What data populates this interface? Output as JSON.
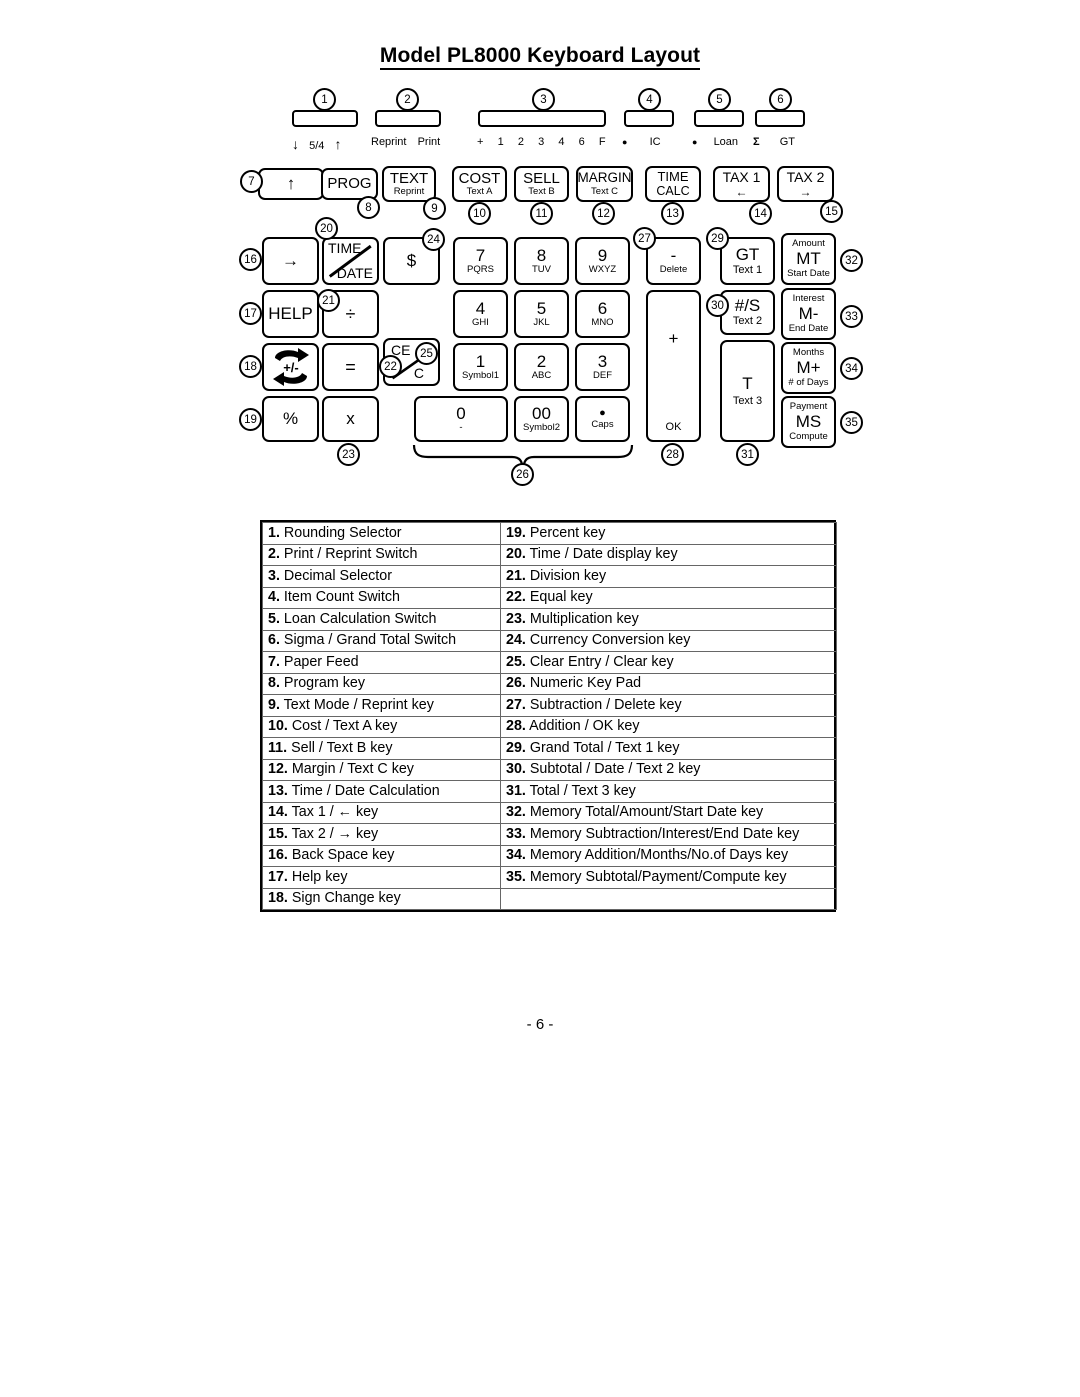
{
  "document": {
    "title": "Model PL8000 Keyboard Layout",
    "page_number": "- 6 -"
  },
  "switches": [
    {
      "callout": "1",
      "labels": [
        "↓",
        "5/4",
        "↑"
      ]
    },
    {
      "callout": "2",
      "labels": [
        "Reprint",
        "Print"
      ]
    },
    {
      "callout": "3",
      "labels": [
        "+",
        "1",
        "2",
        "3",
        "4",
        "6",
        "F"
      ]
    },
    {
      "callout": "4",
      "labels": [
        "●",
        "IC"
      ]
    },
    {
      "callout": "5",
      "labels": [
        "●",
        "Loan"
      ]
    },
    {
      "callout": "6",
      "labels": [
        "Σ",
        "GT"
      ]
    }
  ],
  "keys": [
    {
      "callout": "7",
      "main": "↑",
      "sub": "",
      "sup": ""
    },
    {
      "callout": "8",
      "main": "PROG",
      "sub": "",
      "sup": ""
    },
    {
      "callout": "9",
      "main": "TEXT",
      "sub": "Reprint",
      "sup": ""
    },
    {
      "callout": "10",
      "main": "COST",
      "sub": "Text A",
      "sup": ""
    },
    {
      "callout": "11",
      "main": "SELL",
      "sub": "Text B",
      "sup": ""
    },
    {
      "callout": "12",
      "main": "MARGIN",
      "sub": "Text C",
      "sup": ""
    },
    {
      "callout": "13",
      "main": "TIME",
      "sub": "CALC",
      "sup": ""
    },
    {
      "callout": "14",
      "main": "TAX 1",
      "sub": "←",
      "sup": ""
    },
    {
      "callout": "15",
      "main": "TAX 2",
      "sub": "→",
      "sup": ""
    },
    {
      "callout": "16",
      "main": "→",
      "sub": "",
      "sup": ""
    },
    {
      "callout": "20",
      "main": "TIME",
      "sub": "DATE",
      "sup": ""
    },
    {
      "callout": "24",
      "main": "$",
      "sub": "",
      "sup": ""
    },
    {
      "callout": "17",
      "main": "HELP",
      "sub": "",
      "sup": ""
    },
    {
      "callout": "21",
      "main": "÷",
      "sub": "",
      "sup": ""
    },
    {
      "callout": "25",
      "main": "CE",
      "sub": "C",
      "sup": ""
    },
    {
      "callout": "18",
      "main": "+/-",
      "sub": "",
      "sup": ""
    },
    {
      "callout": "22",
      "main": "=",
      "sub": "",
      "sup": ""
    },
    {
      "callout": "19",
      "main": "%",
      "sub": "",
      "sup": ""
    },
    {
      "callout": "23",
      "main": "x",
      "sub": "",
      "sup": ""
    },
    {
      "callout": "27",
      "main": "-",
      "sub": "Delete",
      "sup": ""
    },
    {
      "callout": "28",
      "main": "+",
      "sub": "OK",
      "sup": ""
    },
    {
      "callout": "29",
      "main": "GT",
      "sub": "Text 1",
      "sup": ""
    },
    {
      "callout": "30",
      "main": "#/S",
      "sub": "Text 2",
      "sup": ""
    },
    {
      "callout": "31",
      "main": "T",
      "sub": "Text 3",
      "sup": ""
    },
    {
      "callout": "32",
      "main": "MT",
      "sub": "Start Date",
      "sup": "Amount"
    },
    {
      "callout": "33",
      "main": "M-",
      "sub": "End Date",
      "sup": "Interest"
    },
    {
      "callout": "34",
      "main": "M+",
      "sub": "# of Days",
      "sup": "Months"
    },
    {
      "callout": "35",
      "main": "MS",
      "sub": "Compute",
      "sup": "Payment"
    }
  ],
  "numeric_pad": {
    "callout": "26",
    "keys": [
      {
        "main": "7",
        "sub": "PQRS"
      },
      {
        "main": "8",
        "sub": "TUV"
      },
      {
        "main": "9",
        "sub": "WXYZ"
      },
      {
        "main": "4",
        "sub": "GHI"
      },
      {
        "main": "5",
        "sub": "JKL"
      },
      {
        "main": "6",
        "sub": "MNO"
      },
      {
        "main": "1",
        "sub": "Symbol1"
      },
      {
        "main": "2",
        "sub": "ABC"
      },
      {
        "main": "3",
        "sub": "DEF"
      },
      {
        "main": "0",
        "sub": "-"
      },
      {
        "main": "00",
        "sub": "Symbol2"
      },
      {
        "main": "●",
        "sub": "Caps"
      }
    ]
  },
  "legend": {
    "rows": [
      {
        "left_num": "1.",
        "left_text": "Rounding Selector",
        "right_num": "19.",
        "right_text": "Percent key"
      },
      {
        "left_num": "2.",
        "left_text": "Print / Reprint Switch",
        "right_num": "20.",
        "right_text": "Time / Date display key"
      },
      {
        "left_num": "3.",
        "left_text": "Decimal Selector",
        "right_num": "21.",
        "right_text": "Division key"
      },
      {
        "left_num": "4.",
        "left_text": "Item Count Switch",
        "right_num": "22.",
        "right_text": "Equal key"
      },
      {
        "left_num": "5.",
        "left_text": "Loan Calculation Switch",
        "right_num": "23.",
        "right_text": "Multiplication key"
      },
      {
        "left_num": "6.",
        "left_text": "Sigma / Grand Total Switch",
        "right_num": "24.",
        "right_text": "Currency Conversion key"
      },
      {
        "left_num": "7.",
        "left_text": "Paper Feed",
        "right_num": "25.",
        "right_text": "Clear Entry / Clear key"
      },
      {
        "left_num": "8.",
        "left_text": "Program key",
        "right_num": "26.",
        "right_text": "Numeric Key Pad"
      },
      {
        "left_num": "9.",
        "left_text": "Text Mode / Reprint key",
        "right_num": "27.",
        "right_text": "Subtraction / Delete key"
      },
      {
        "left_num": "10.",
        "left_text": "Cost / Text A key",
        "right_num": "28.",
        "right_text": "Addition / OK key"
      },
      {
        "left_num": "11.",
        "left_text": "Sell / Text B key",
        "right_num": "29.",
        "right_text": "Grand Total / Text 1 key"
      },
      {
        "left_num": "12.",
        "left_text": "Margin / Text C key",
        "right_num": "30.",
        "right_text": "Subtotal / Date / Text 2 key"
      },
      {
        "left_num": "13.",
        "left_text": "Time / Date Calculation",
        "right_num": "31.",
        "right_text": "Total / Text 3 key"
      },
      {
        "left_num": "14.",
        "left_text": "Tax 1 / ← key",
        "right_num": "32.",
        "right_text": "Memory Total/Amount/Start Date key"
      },
      {
        "left_num": "15.",
        "left_text": "Tax 2 / → key",
        "right_num": "33.",
        "right_text": "Memory Subtraction/Interest/End Date key"
      },
      {
        "left_num": "16.",
        "left_text": "Back Space key",
        "right_num": "34.",
        "right_text": "Memory Addition/Months/No.of Days key"
      },
      {
        "left_num": "17.",
        "left_text": "Help key",
        "right_num": "35.",
        "right_text": "Memory Subtotal/Payment/Compute key"
      },
      {
        "left_num": "18.",
        "left_text": "Sign Change key",
        "right_num": "",
        "right_text": ""
      }
    ]
  }
}
